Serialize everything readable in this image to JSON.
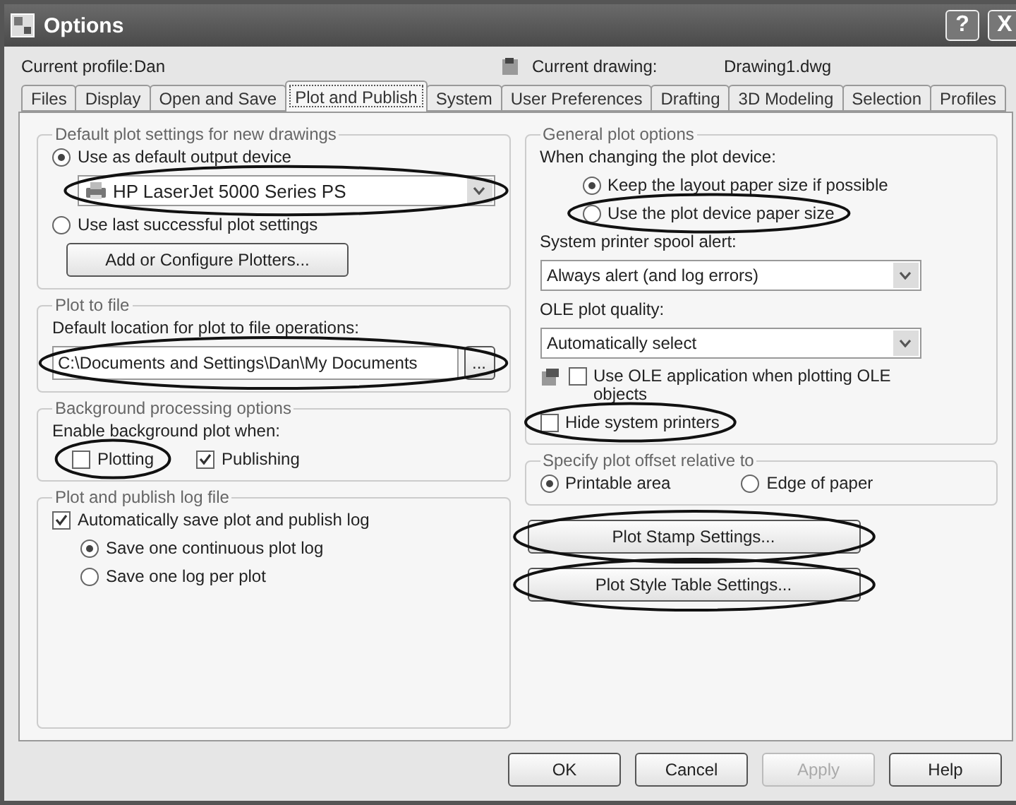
{
  "window": {
    "title": "Options",
    "buttons": [
      "?",
      "X"
    ]
  },
  "profile": {
    "label": "Current profile:",
    "value": "Dan",
    "drawing_label": "Current drawing:",
    "drawing_value": "Drawing1.dwg"
  },
  "tabs": [
    {
      "label": "Files",
      "selected": false
    },
    {
      "label": "Display",
      "selected": false
    },
    {
      "label": "Open and Save",
      "selected": false
    },
    {
      "label": "Plot and Publish",
      "selected": true
    },
    {
      "label": "System",
      "selected": false
    },
    {
      "label": "User Preferences",
      "selected": false
    },
    {
      "label": "Drafting",
      "selected": false
    },
    {
      "label": "3D Modeling",
      "selected": false
    },
    {
      "label": "Selection",
      "selected": false
    },
    {
      "label": "Profiles",
      "selected": false
    }
  ],
  "default_plot": {
    "title": "Default plot settings for new drawings",
    "options": [
      {
        "label": "Use as default output device",
        "selected": true
      },
      {
        "label": "Use last successful plot settings",
        "selected": false
      }
    ],
    "device": {
      "value": "HP LaserJet 5000 Series PS",
      "highlighted": true
    },
    "button": "Add or Configure Plotters..."
  },
  "plot_to_file": {
    "title": "Plot to file",
    "label": "Default location for plot to file operations:",
    "path": {
      "value": "C:\\Documents and Settings\\Dan\\My Documents",
      "highlighted": true
    },
    "browse": "..."
  },
  "background": {
    "title": "Background processing options",
    "label": "Enable background plot when:",
    "checks": [
      {
        "label": "Plotting",
        "checked": false,
        "highlighted": true
      },
      {
        "label": "Publishing",
        "checked": true,
        "highlighted": false
      }
    ]
  },
  "log": {
    "title": "Plot and publish log file",
    "auto": {
      "label": "Automatically save plot and publish log",
      "checked": true
    },
    "options": [
      {
        "label": "Save one continuous plot log",
        "selected": true
      },
      {
        "label": "Save one log per plot",
        "selected": false
      }
    ]
  },
  "general": {
    "title": "General plot options",
    "label": "When changing the plot device:",
    "options": [
      {
        "label": "Keep the layout paper size if possible",
        "selected": true,
        "highlighted": false
      },
      {
        "label": "Use the plot device paper size",
        "selected": false,
        "highlighted": true
      }
    ],
    "spool_label": "System printer spool alert:",
    "spool": "Always alert (and log errors)",
    "ole_label": "OLE plot quality:",
    "ole": "Automatically select",
    "ole_app": {
      "label": "Use OLE application when plotting OLE objects",
      "checked": false
    },
    "hide": {
      "label": "Hide system printers",
      "checked": false,
      "highlighted": true
    }
  },
  "offset": {
    "title": "Specify plot offset relative to",
    "options": [
      {
        "label": "Printable area",
        "selected": true
      },
      {
        "label": "Edge of paper",
        "selected": false
      }
    ]
  },
  "settings_buttons": [
    {
      "label": "Plot Stamp Settings...",
      "highlighted": true
    },
    {
      "label": "Plot Style Table Settings...",
      "highlighted": true
    }
  ],
  "footer": [
    {
      "label": "OK",
      "disabled": false
    },
    {
      "label": "Cancel",
      "disabled": false
    },
    {
      "label": "Apply",
      "disabled": true
    },
    {
      "label": "Help",
      "disabled": false
    }
  ]
}
